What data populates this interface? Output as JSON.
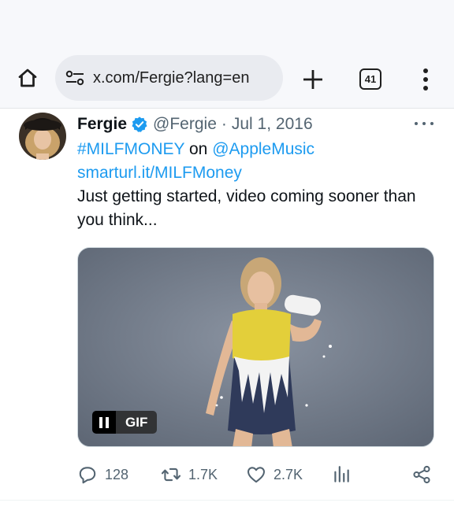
{
  "browser": {
    "url": "x.com/Fergie?lang=en",
    "tab_count": "41",
    "icons": {
      "home": "home-icon",
      "site_settings": "tune-icon",
      "new_tab": "plus-icon",
      "tabs": "tab-switcher-icon",
      "menu": "more-vert-icon"
    }
  },
  "tweet": {
    "author_name": "Fergie",
    "handle": "@Fergie",
    "separator": "·",
    "date": "Jul 1, 2016",
    "verified": true,
    "hashtag": "#MILFMONEY",
    "on_word": " on ",
    "mention": "@AppleMusic",
    "link": "smarturl.it/MILFMoney",
    "body": "Just getting started, video coming sooner than you think...",
    "media": {
      "type": "gif",
      "badge_label": "GIF",
      "paused_control": "pause-icon"
    },
    "stats": {
      "replies": "128",
      "retweets": "1.7K",
      "likes": "2.7K"
    }
  },
  "colors": {
    "link": "#1d9bf0",
    "verified_badge": "#1d9bf0",
    "secondary_text": "#536471",
    "primary_text": "#0f1419"
  }
}
